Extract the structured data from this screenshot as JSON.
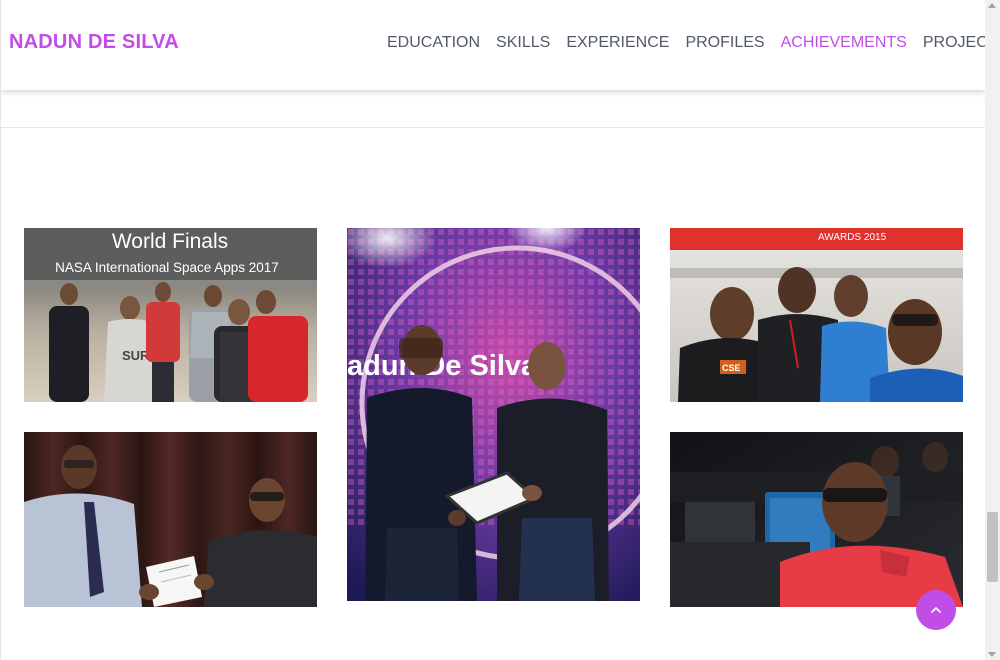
{
  "navbar": {
    "brand": "NADUN DE SILVA",
    "links": [
      {
        "label": "EDUCATION",
        "active": false
      },
      {
        "label": "SKILLS",
        "active": false
      },
      {
        "label": "EXPERIENCE",
        "active": false
      },
      {
        "label": "PROFILES",
        "active": false
      },
      {
        "label": "ACHIEVEMENTS",
        "active": true
      },
      {
        "label": "PROJECTS",
        "active": false
      }
    ]
  },
  "gallery": {
    "photo1": {
      "title_line": "World Finals",
      "subtitle_line": "NASA International Space Apps 2017"
    },
    "photo2": {
      "stage_text": "adun De Silva"
    },
    "photo3": {
      "banner_text": "AWARDS 2015",
      "badge_text": "CSE"
    }
  },
  "colors": {
    "accent": "#c04ee6",
    "nav_text": "#525a66"
  },
  "icons": {
    "scroll_top": "chevron-up-icon"
  }
}
